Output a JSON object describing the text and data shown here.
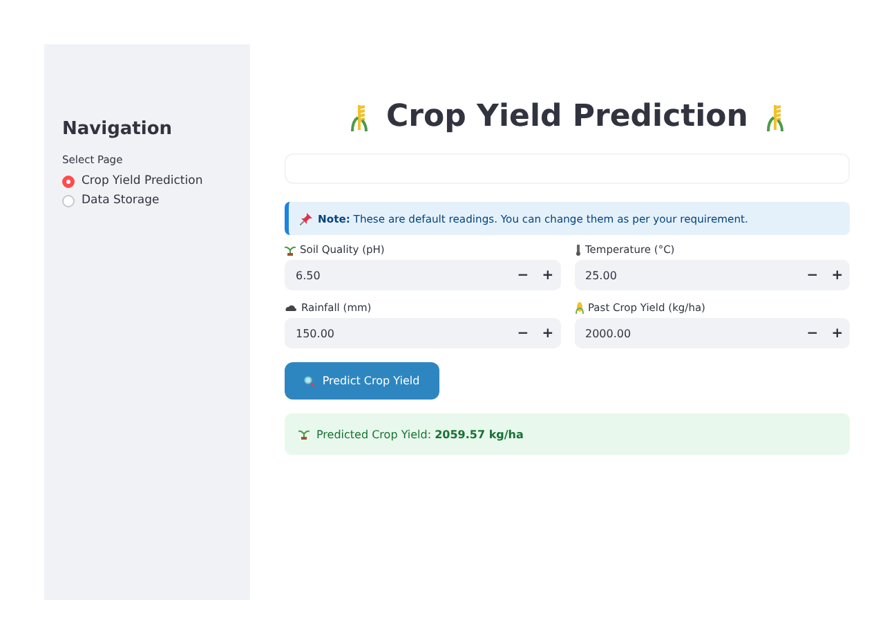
{
  "sidebar": {
    "title": "Navigation",
    "radio_label": "Select Page",
    "options": [
      {
        "label": "Crop Yield Prediction",
        "selected": true
      },
      {
        "label": "Data Storage",
        "selected": false
      }
    ]
  },
  "main": {
    "title": "Crop Yield Prediction",
    "note": "**Note:** These are default readings. You can change them as per your requirement.",
    "fields": [
      {
        "label": "Soil Quality (pH)",
        "value": "6.50"
      },
      {
        "label": "Temperature (°C)",
        "value": "25.00"
      },
      {
        "label": "Rainfall (mm)",
        "value": "150.00"
      },
      {
        "label": "Past Crop Yield (kg/ha)",
        "value": "2000.00"
      }
    ],
    "minus": "−",
    "plus": "+",
    "button": "Predict Crop Yield",
    "result": "Predicted Crop Yield: **2059.57 kg/ha**"
  }
}
